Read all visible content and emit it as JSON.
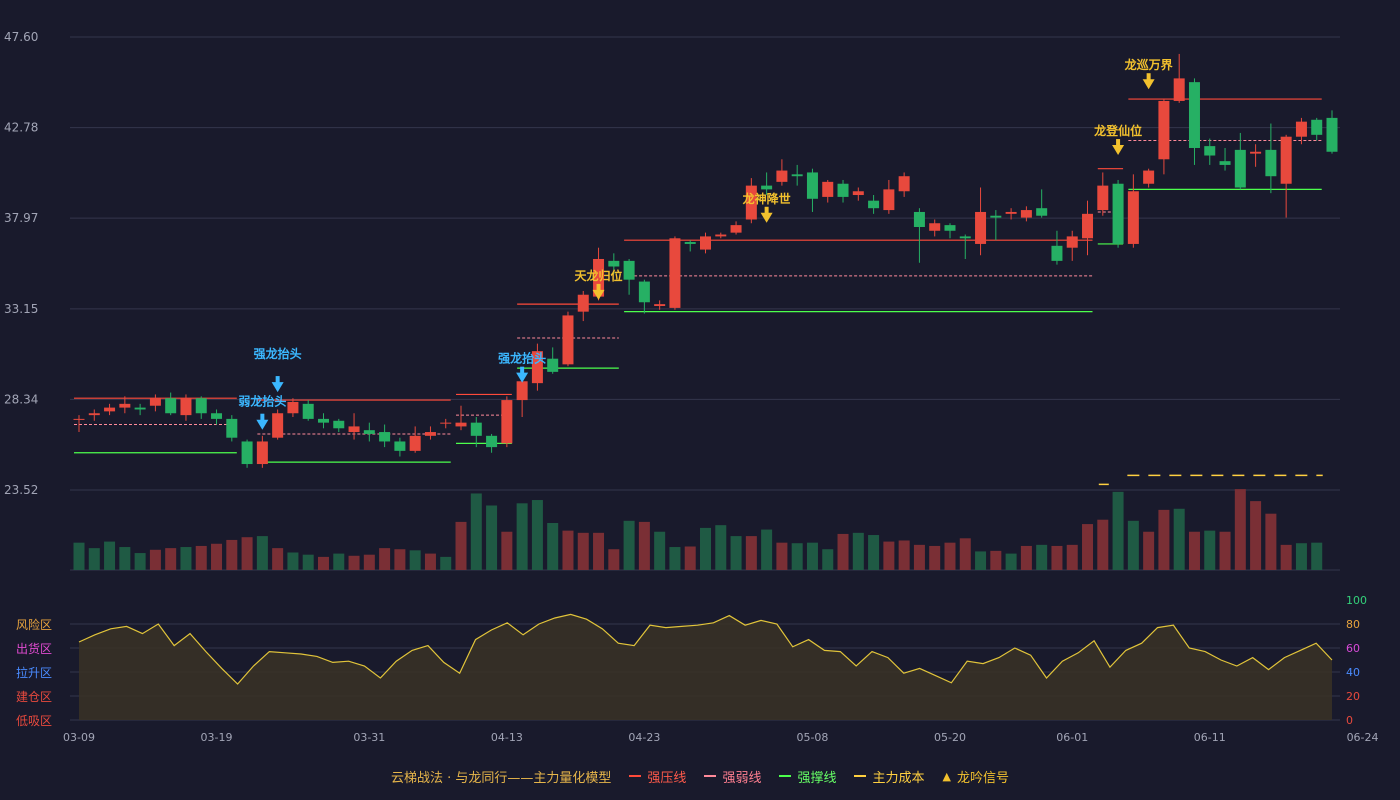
{
  "chart_data": {
    "type": "candlestick",
    "price_axis": {
      "ticks": [
        47.6,
        42.78,
        37.97,
        33.15,
        28.34,
        23.52
      ],
      "range": [
        23.52,
        47.6
      ]
    },
    "dates": [
      "03-09",
      "03-10",
      "03-11",
      "03-12",
      "03-13",
      "03-14",
      "03-16",
      "03-17",
      "03-18",
      "03-19",
      "03-20",
      "03-21",
      "03-23",
      "03-24",
      "03-25",
      "03-26",
      "03-27",
      "03-28",
      "03-30",
      "03-31",
      "04-01",
      "04-02",
      "04-03",
      "04-06",
      "04-07",
      "04-08",
      "04-09",
      "04-10",
      "04-13",
      "04-14",
      "04-15",
      "04-16",
      "04-17",
      "04-18",
      "04-20",
      "04-21",
      "04-22",
      "04-23",
      "04-24",
      "04-25",
      "04-27",
      "04-28",
      "04-29",
      "04-30",
      "05-04",
      "05-05",
      "05-06",
      "05-07",
      "05-08",
      "05-09",
      "05-11",
      "05-12",
      "05-13",
      "05-14",
      "05-15",
      "05-18",
      "05-19",
      "05-20",
      "05-21",
      "05-22",
      "05-25",
      "05-26",
      "05-27",
      "05-28",
      "05-29",
      "06-01",
      "06-02",
      "06-03",
      "06-04",
      "06-05",
      "06-06",
      "06-08",
      "06-09",
      "06-10",
      "06-11",
      "06-12",
      "06-13",
      "06-15",
      "06-16",
      "06-17",
      "06-18",
      "06-19",
      "06-22",
      "06-23",
      "06-24",
      "06-25",
      "06-26",
      "06-27",
      "06-29",
      "06-30",
      "07-01"
    ],
    "x_tick_labels": [
      "03-09",
      "03-19",
      "03-31",
      "04-13",
      "04-23",
      "05-08",
      "05-20",
      "06-01",
      "06-11",
      "06-24"
    ],
    "ohlc": [
      [
        27.3,
        27.3,
        26.6,
        27.5
      ],
      [
        27.5,
        27.6,
        27.2,
        27.8
      ],
      [
        27.7,
        27.9,
        27.5,
        28.1
      ],
      [
        27.9,
        28.1,
        27.6,
        28.5
      ],
      [
        27.9,
        27.8,
        27.5,
        28.1
      ],
      [
        28.0,
        28.4,
        27.7,
        28.6
      ],
      [
        28.4,
        27.6,
        27.5,
        28.7
      ],
      [
        27.5,
        28.4,
        27.2,
        28.6
      ],
      [
        28.4,
        27.6,
        27.3,
        28.5
      ],
      [
        27.6,
        27.3,
        27.0,
        27.8
      ],
      [
        27.3,
        26.3,
        26.1,
        27.5
      ],
      [
        26.1,
        24.9,
        24.7,
        26.2
      ],
      [
        24.9,
        26.1,
        24.7,
        26.4
      ],
      [
        26.3,
        27.6,
        26.2,
        27.8
      ],
      [
        27.6,
        28.2,
        27.4,
        28.4
      ],
      [
        28.1,
        27.3,
        27.2,
        28.3
      ],
      [
        27.3,
        27.1,
        26.8,
        27.6
      ],
      [
        27.2,
        26.8,
        26.6,
        27.3
      ],
      [
        26.6,
        26.9,
        26.2,
        27.6
      ],
      [
        26.7,
        26.5,
        26.1,
        27.1
      ],
      [
        26.6,
        26.1,
        25.8,
        27.0
      ],
      [
        26.1,
        25.6,
        25.3,
        26.3
      ],
      [
        25.6,
        26.4,
        25.5,
        26.9
      ],
      [
        26.4,
        26.6,
        26.2,
        26.9
      ],
      [
        27.1,
        27.1,
        26.8,
        27.3
      ],
      [
        26.9,
        27.1,
        26.7,
        28.0
      ],
      [
        27.1,
        26.4,
        25.8,
        27.4
      ],
      [
        26.4,
        25.8,
        25.5,
        26.5
      ],
      [
        26.0,
        28.3,
        25.8,
        28.5
      ],
      [
        28.3,
        29.3,
        27.4,
        29.5
      ],
      [
        29.2,
        30.9,
        28.8,
        31.3
      ],
      [
        30.5,
        29.8,
        29.7,
        31.1
      ],
      [
        30.2,
        32.8,
        30.1,
        33.0
      ],
      [
        33.0,
        33.9,
        32.5,
        34.1
      ],
      [
        33.8,
        35.8,
        33.6,
        36.4
      ],
      [
        35.7,
        35.4,
        35.0,
        36.1
      ],
      [
        35.7,
        34.7,
        33.9,
        35.8
      ],
      [
        34.6,
        33.5,
        32.9,
        34.7
      ],
      [
        33.3,
        33.4,
        33.1,
        33.6
      ],
      [
        33.2,
        36.9,
        33.1,
        37.0
      ],
      [
        36.7,
        36.6,
        36.2,
        36.8
      ],
      [
        36.3,
        37.0,
        36.1,
        37.2
      ],
      [
        37.0,
        37.1,
        36.9,
        37.2
      ],
      [
        37.2,
        37.6,
        37.1,
        37.8
      ],
      [
        37.9,
        39.7,
        37.7,
        40.1
      ],
      [
        39.7,
        39.5,
        39.2,
        40.4
      ],
      [
        39.9,
        40.5,
        39.7,
        41.1
      ],
      [
        40.3,
        40.2,
        39.7,
        40.8
      ],
      [
        40.4,
        39.0,
        38.3,
        40.6
      ],
      [
        39.1,
        39.9,
        38.8,
        40.0
      ],
      [
        39.8,
        39.1,
        38.8,
        40.0
      ],
      [
        39.2,
        39.4,
        38.9,
        39.6
      ],
      [
        38.9,
        38.5,
        38.2,
        39.2
      ],
      [
        38.4,
        39.5,
        38.2,
        40.0
      ],
      [
        39.4,
        40.2,
        39.1,
        40.4
      ],
      [
        38.3,
        37.5,
        35.6,
        38.5
      ],
      [
        37.3,
        37.7,
        37.0,
        37.9
      ],
      [
        37.6,
        37.3,
        36.9,
        37.7
      ],
      [
        37.0,
        36.9,
        35.8,
        37.1
      ],
      [
        36.6,
        38.3,
        36.0,
        39.6
      ],
      [
        38.1,
        38.0,
        36.8,
        38.4
      ],
      [
        38.2,
        38.3,
        37.9,
        38.5
      ],
      [
        38.0,
        38.4,
        37.8,
        38.6
      ],
      [
        38.5,
        38.1,
        38.0,
        39.5
      ],
      [
        36.5,
        35.7,
        35.5,
        37.3
      ],
      [
        36.4,
        37.0,
        35.7,
        37.3
      ],
      [
        36.9,
        38.2,
        36.0,
        38.9
      ],
      [
        38.4,
        39.7,
        38.1,
        40.4
      ],
      [
        39.8,
        36.6,
        36.4,
        40.0
      ],
      [
        36.6,
        39.4,
        36.4,
        40.3
      ],
      [
        39.8,
        40.5,
        39.6,
        40.6
      ],
      [
        41.1,
        44.2,
        40.3,
        44.3
      ],
      [
        44.2,
        45.4,
        44.1,
        46.7
      ],
      [
        45.2,
        41.7,
        40.8,
        45.4
      ],
      [
        41.8,
        41.3,
        40.8,
        42.2
      ],
      [
        41.0,
        40.8,
        40.5,
        41.7
      ],
      [
        41.6,
        39.6,
        39.5,
        42.5
      ],
      [
        41.4,
        41.5,
        40.7,
        41.9
      ],
      [
        41.6,
        40.2,
        39.3,
        43.0
      ],
      [
        39.8,
        42.3,
        38.0,
        42.4
      ],
      [
        42.3,
        43.1,
        41.9,
        43.3
      ],
      [
        43.2,
        42.4,
        42.1,
        43.3
      ],
      [
        43.3,
        41.5,
        41.4,
        43.7
      ]
    ],
    "volume": [
      50,
      40,
      52,
      42,
      31,
      37,
      40,
      42,
      44,
      48,
      55,
      60,
      62,
      40,
      32,
      28,
      24,
      30,
      26,
      28,
      40,
      38,
      36,
      30,
      24,
      88,
      140,
      118,
      70,
      122,
      128,
      86,
      72,
      68,
      68,
      38,
      90,
      88,
      70,
      42,
      43,
      77,
      82,
      62,
      62,
      74,
      50,
      49,
      50,
      38,
      66,
      68,
      64,
      52,
      54,
      46,
      44,
      50,
      58,
      34,
      35,
      30,
      44,
      46,
      44,
      46,
      84,
      92,
      143,
      90,
      70,
      110,
      112,
      70,
      72,
      70,
      148,
      126,
      103,
      46,
      49,
      50
    ],
    "volume_colors": [
      "g",
      "g",
      "g",
      "g",
      "g",
      "r",
      "r",
      "g",
      "r",
      "r",
      "r",
      "r",
      "g",
      "r",
      "g",
      "g",
      "r",
      "g",
      "r",
      "r",
      "r",
      "r",
      "g",
      "r",
      "g",
      "r",
      "g",
      "g",
      "r",
      "g",
      "g",
      "g",
      "r",
      "r",
      "r",
      "r",
      "g",
      "r",
      "g",
      "g",
      "r",
      "g",
      "g",
      "g",
      "r",
      "g",
      "r",
      "g",
      "g",
      "g",
      "r",
      "g",
      "g",
      "r",
      "r",
      "r",
      "r",
      "r",
      "r",
      "g",
      "r",
      "g",
      "r",
      "g",
      "r",
      "r",
      "r",
      "r",
      "g",
      "g",
      "r",
      "r",
      "g",
      "r",
      "g",
      "r",
      "r",
      "r",
      "r",
      "r",
      "g",
      "g"
    ],
    "oscillator": {
      "name": "",
      "ticks": [
        0,
        20,
        40,
        60,
        80,
        100
      ],
      "zones": [
        "风险区",
        "出货区",
        "拉升区",
        "建仓区",
        "低吸区"
      ],
      "values": [
        65,
        71,
        76,
        78,
        72,
        80,
        62,
        72,
        57,
        43,
        30,
        45,
        57,
        56,
        55,
        53,
        48,
        49,
        45,
        35,
        49,
        58,
        62,
        48,
        39,
        67,
        75,
        81,
        71,
        80,
        85,
        88,
        84,
        76,
        64,
        62,
        79,
        77,
        78,
        79,
        81,
        87,
        79,
        83,
        80,
        61,
        67,
        58,
        57,
        45,
        57,
        52,
        39,
        43,
        37,
        31,
        49,
        47,
        52,
        60,
        54,
        35,
        49,
        56,
        66,
        44,
        58,
        64,
        77,
        79,
        60,
        57,
        50,
        45,
        52,
        42,
        52,
        58,
        64,
        50
      ]
    },
    "signals": [
      {
        "date": "03-24",
        "label": "弱龙抬头",
        "color": "#3bb7ff"
      },
      {
        "date": "03-25",
        "label": "强龙抬头",
        "color": "#3bb7ff"
      },
      {
        "date": "04-14",
        "label": "强龙抬头",
        "color": "#3bb7ff"
      },
      {
        "date": "04-20",
        "label": "天龙归位",
        "color": "#f2c12e"
      },
      {
        "date": "05-05",
        "label": "龙神降世",
        "color": "#f2c12e"
      },
      {
        "date": "06-16",
        "label": "龙登仙位",
        "color": "#f2c12e"
      },
      {
        "date": "06-18",
        "label": "龙巡万界",
        "color": "#f2c12e"
      }
    ]
  },
  "legend": {
    "title": "云梯战法 · 与龙同行——主力量化模型",
    "resist": "强压线",
    "weak": "强弱线",
    "support": "强撑线",
    "cost": "主力成本",
    "signal": "龙吟信号"
  },
  "colors": {
    "up": "#e8493d",
    "down": "#26b064",
    "grid": "#34364c",
    "axis_text": "#a2a5b6",
    "signal_gold": "#f2c12e",
    "signal_blue": "#3bb7ff",
    "osc_line": "#e1c43a"
  }
}
